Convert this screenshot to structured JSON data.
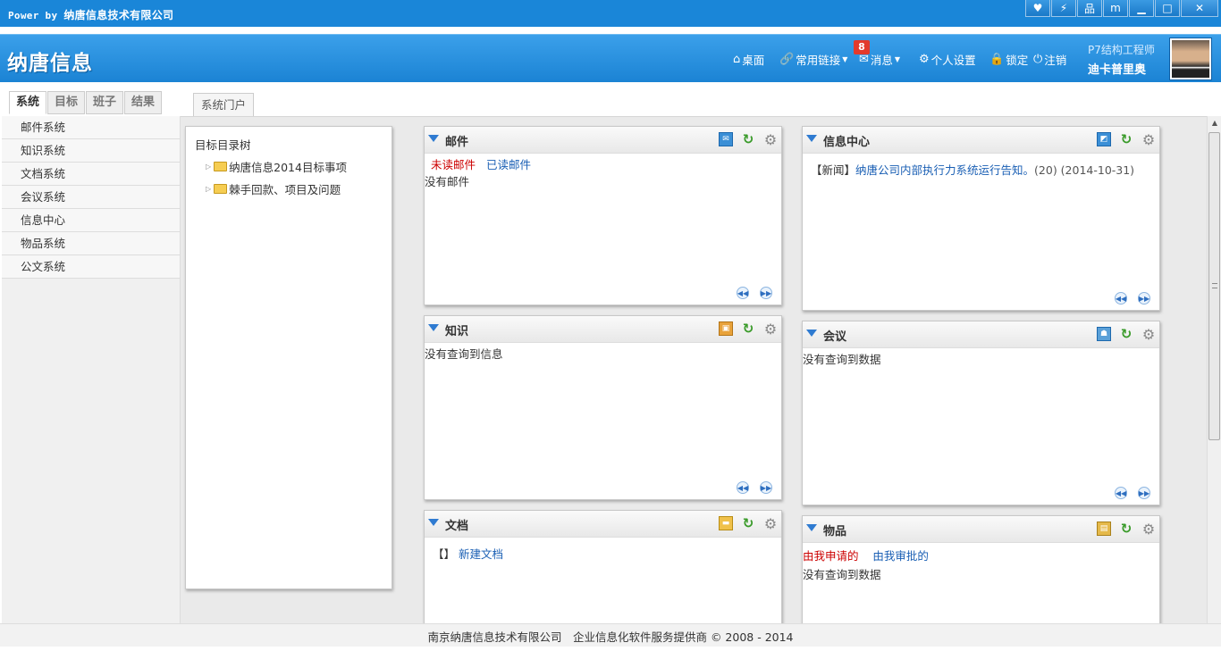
{
  "titlebar": {
    "power_prefix": "Power by",
    "company": "纳唐信息技术有限公司"
  },
  "header": {
    "logo": "纳唐信息",
    "nav": {
      "desktop": "桌面",
      "links": "常用链接",
      "messages": "消息",
      "message_count": "8",
      "settings": "个人设置",
      "lock": "锁定",
      "logout": "注销"
    },
    "user": {
      "role": "P7结构工程师",
      "name": "迪卡普里奥"
    }
  },
  "sidebar": {
    "tabs": [
      "系统",
      "目标",
      "班子",
      "结果"
    ],
    "items": [
      "邮件系统",
      "知识系统",
      "文档系统",
      "会议系统",
      "信息中心",
      "物品系统",
      "公文系统"
    ]
  },
  "portal_tab": "系统门户",
  "tree": {
    "title": "目标目录树",
    "nodes": [
      "纳唐信息2014目标事项",
      "棘手回款、项目及问题"
    ]
  },
  "portlets": {
    "mail": {
      "title": "邮件",
      "unread": "未读邮件",
      "read": "已读邮件",
      "empty": "没有邮件"
    },
    "knowledge": {
      "title": "知识",
      "empty": "没有查询到信息"
    },
    "docs": {
      "title": "文档",
      "bracket": "【】",
      "new_doc": "新建文档"
    },
    "info": {
      "title": "信息中心",
      "tag": "【新闻】",
      "link": "纳唐公司内部执行力系统运行告知。",
      "meta": "(20) (2014-10-31)"
    },
    "meeting": {
      "title": "会议",
      "empty": "没有查询到数据"
    },
    "goods": {
      "title": "物品",
      "mine": "由我申请的",
      "approve": "由我审批的",
      "empty": "没有查询到数据"
    }
  },
  "footer": "南京纳唐信息技术有限公司　企业信息化软件服务提供商 © 2008 - 2014"
}
